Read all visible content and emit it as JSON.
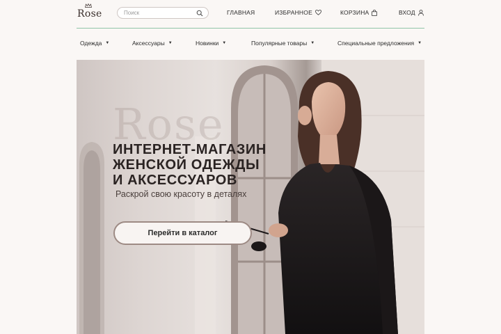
{
  "brand": {
    "logo_text": "Rose"
  },
  "search": {
    "placeholder": "Поиск"
  },
  "top_nav": {
    "home": "ГЛАВНАЯ",
    "favorites": "ИЗБРАННОЕ",
    "cart": "КОРЗИНА",
    "login": "ВХОД"
  },
  "categories": [
    {
      "label": "Одежда"
    },
    {
      "label": "Аксессуары"
    },
    {
      "label": "Новинки"
    },
    {
      "label": "Популярные товары"
    },
    {
      "label": "Специальные предложения"
    }
  ],
  "hero": {
    "watermark": "Rose",
    "title_lines": [
      "ИНТЕРНЕТ-МАГАЗИН",
      "ЖЕНСКОЙ ОДЕЖДЫ",
      "И АКСЕССУАРОВ"
    ],
    "subtitle": "Раскрой свою красоту в деталях",
    "cta_label": "Перейти в каталог"
  },
  "colors": {
    "divider": "#8fc4a8",
    "page_bg": "#faf7f5",
    "cta_border": "#9d8a84"
  },
  "icons": [
    "search-icon",
    "heart-icon",
    "bag-icon",
    "user-icon",
    "crown-icon",
    "caret-down-icon"
  ]
}
